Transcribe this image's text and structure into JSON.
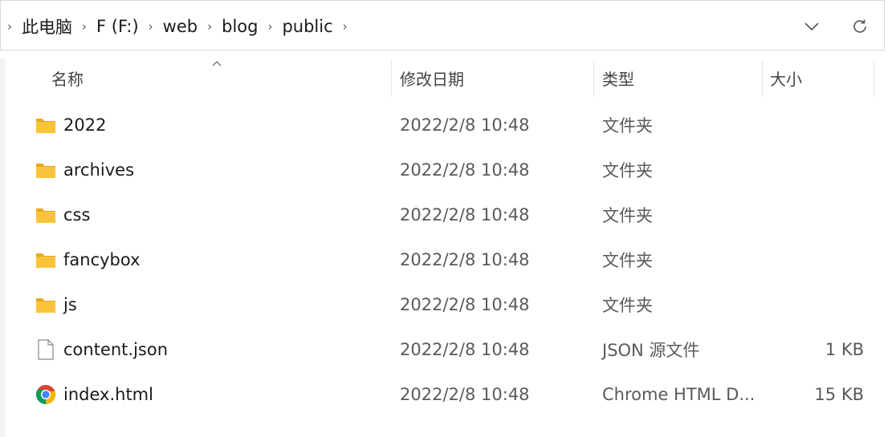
{
  "breadcrumb": {
    "items": [
      "此电脑",
      "F (F:)",
      "web",
      "blog",
      "public"
    ]
  },
  "columns": {
    "name": "名称",
    "date": "修改日期",
    "type": "类型",
    "size": "大小"
  },
  "files": [
    {
      "name": "2022",
      "date": "2022/2/8 10:48",
      "type": "文件夹",
      "size": "",
      "icon": "folder-icon"
    },
    {
      "name": "archives",
      "date": "2022/2/8 10:48",
      "type": "文件夹",
      "size": "",
      "icon": "folder-icon"
    },
    {
      "name": "css",
      "date": "2022/2/8 10:48",
      "type": "文件夹",
      "size": "",
      "icon": "folder-icon"
    },
    {
      "name": "fancybox",
      "date": "2022/2/8 10:48",
      "type": "文件夹",
      "size": "",
      "icon": "folder-icon"
    },
    {
      "name": "js",
      "date": "2022/2/8 10:48",
      "type": "文件夹",
      "size": "",
      "icon": "folder-icon"
    },
    {
      "name": "content.json",
      "date": "2022/2/8 10:48",
      "type": "JSON 源文件",
      "size": "1 KB",
      "icon": "file-icon"
    },
    {
      "name": "index.html",
      "date": "2022/2/8 10:48",
      "type": "Chrome HTML D...",
      "size": "15 KB",
      "icon": "chrome-icon"
    }
  ],
  "colors": {
    "folder": "#f9c43c",
    "folder_dark": "#e8a820",
    "chrome_red": "#db4437",
    "chrome_yellow": "#f4b400",
    "chrome_green": "#0f9d58",
    "chrome_blue": "#4285f4"
  }
}
